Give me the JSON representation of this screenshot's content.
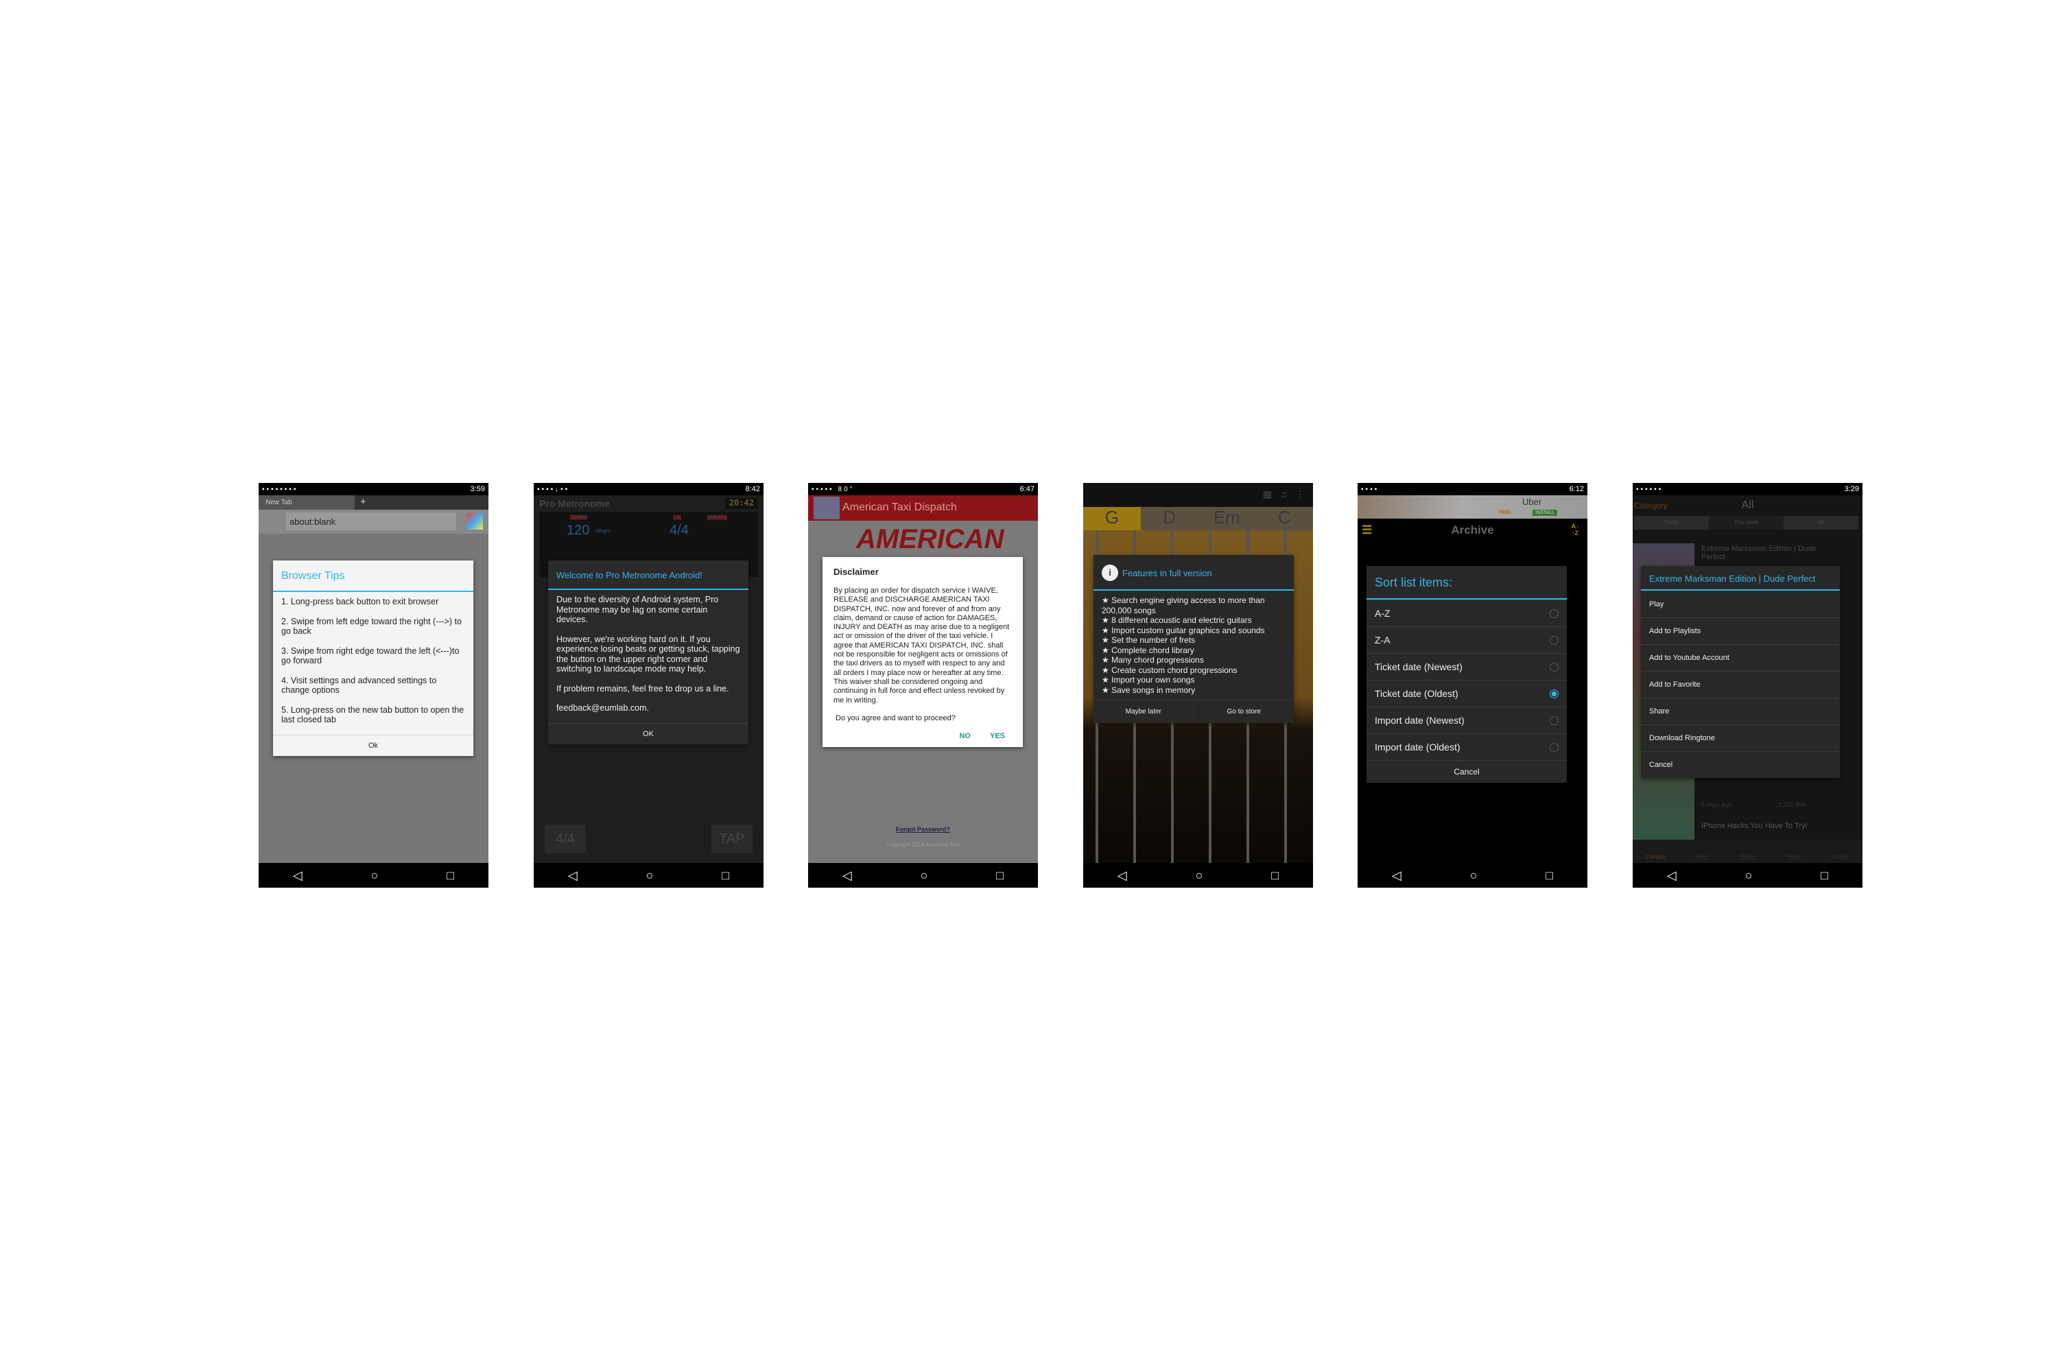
{
  "nav_icons": [
    "back-icon",
    "home-icon",
    "recents-icon"
  ],
  "phones": [
    {
      "time": "3:59",
      "tab": "New Tab",
      "url": "about:blank",
      "dialog": {
        "title": "Browser Tips",
        "items": [
          "1. Long-press back button to exit browser",
          "2. Swipe from left edge toward the right (--->) to go back",
          "3. Swipe from right edge toward the left (<---)to go forward",
          "4. Visit settings and advanced settings to change options",
          "5. Long-press on the new tab button to open the last closed tab"
        ],
        "button": "Ok"
      }
    },
    {
      "time": "8:42",
      "app_title": "Pro Metronome",
      "clock": "20:42",
      "tempo_label": "TEMPO",
      "tempo": "120",
      "tempo_name": "Allegro",
      "ts_label": "T.S.",
      "ts": "4/4",
      "subdiv_label": "SUB DIV.",
      "btn_left": "4/4",
      "btn_right": "TAP",
      "dialog": {
        "title": "Welcome to Pro Metronome Android!",
        "paragraphs": [
          "Due to the diversity of Android system, Pro Metronome may be lag on some certain devices.",
          "However, we're working hard on it. If you experience losing beats or getting stuck, tapping the button on the upper right corner and switching to landscape mode may help.",
          "If problem remains, feel free to drop us a line.",
          "feedback@eumlab.com."
        ],
        "button": "OK"
      }
    },
    {
      "time": "6:47",
      "temp": "80°",
      "app_title": "American Taxi Dispatch",
      "banner": "AMERICAN",
      "forgot": "Forgot Password?",
      "copyright": "Copyright 2013 American Taxi",
      "dialog": {
        "title": "Disclaimer",
        "body": "By placing an order for dispatch service I WAIVE,  RELEASE  and DISCHARGE AMERICAN TAXI DISPATCH, INC. now and forever of and from any claim, demand or cause of action for DAMAGES, INJURY and DEATH as may arise due to a negligent act or omission of the driver of the taxi vehicle. I agree that AMERICAN TAXI DISPATCH, INC. shall not be responsible for negligent acts or omissions of the taxi drivers as to myself with respect to any and all orders I may place now or hereafter at any time. This waiver shall be considered ongoing and continuing in full force and effect unless revoked by me in writing.",
        "question": "Do you agree and want to proceed?",
        "no": "NO",
        "yes": "YES"
      }
    },
    {
      "chords": [
        "G",
        "D",
        "Em",
        "C"
      ],
      "dialog": {
        "title": "Features in full version",
        "items": [
          "★ Search engine giving access to more than 200,000 songs",
          "★ 8 different acoustic and electric guitars",
          "★ Import custom guitar graphics and sounds",
          "★ Set the number of frets",
          "★ Complete chord library",
          "★ Many chord progressions",
          "★ Create custom chord progressions",
          "★ Import your own songs",
          "★ Save songs in memory"
        ],
        "btn_left": "Maybe later",
        "btn_right": "Go to store"
      }
    },
    {
      "time": "6:12",
      "ad_title": "Uber",
      "ad_free": "FREE",
      "ad_install": "INSTALL",
      "app_title": "Archive",
      "sort_icon": "A↓ ↑Z",
      "dialog": {
        "title": "Sort list items:",
        "options": [
          "A-Z",
          "Z-A",
          "Ticket date (Newest)",
          "Ticket date (Oldest)",
          "Import date (Newest)",
          "Import date (Oldest)"
        ],
        "selected": 3,
        "button": "Cancel"
      }
    },
    {
      "time": "3:29",
      "header_left": "Category",
      "header_title": "All",
      "tabs": [
        "Today",
        "This week",
        "All"
      ],
      "video_title": "Extreme Marksman Edition | Dude Perfect",
      "meta_age": "6 days ago",
      "meta_views": "1,220,984",
      "video2": "IPhone Hacks You Have To Try!",
      "bottom_nav": [
        "Category",
        "Search",
        "Playlist",
        "History",
        "Account"
      ],
      "dialog": {
        "title": "Extreme Marksman Edition | Dude Perfect",
        "items": [
          "Play",
          "Add to Playlists",
          "Add to Youtube Account",
          "Add to Favorite",
          "Share",
          "Download Ringtone",
          "Cancel"
        ]
      }
    }
  ],
  "colors": {
    "accent": "#33b5e5",
    "taxi_red": "#b3171c",
    "dialog_dark": "#282828"
  }
}
